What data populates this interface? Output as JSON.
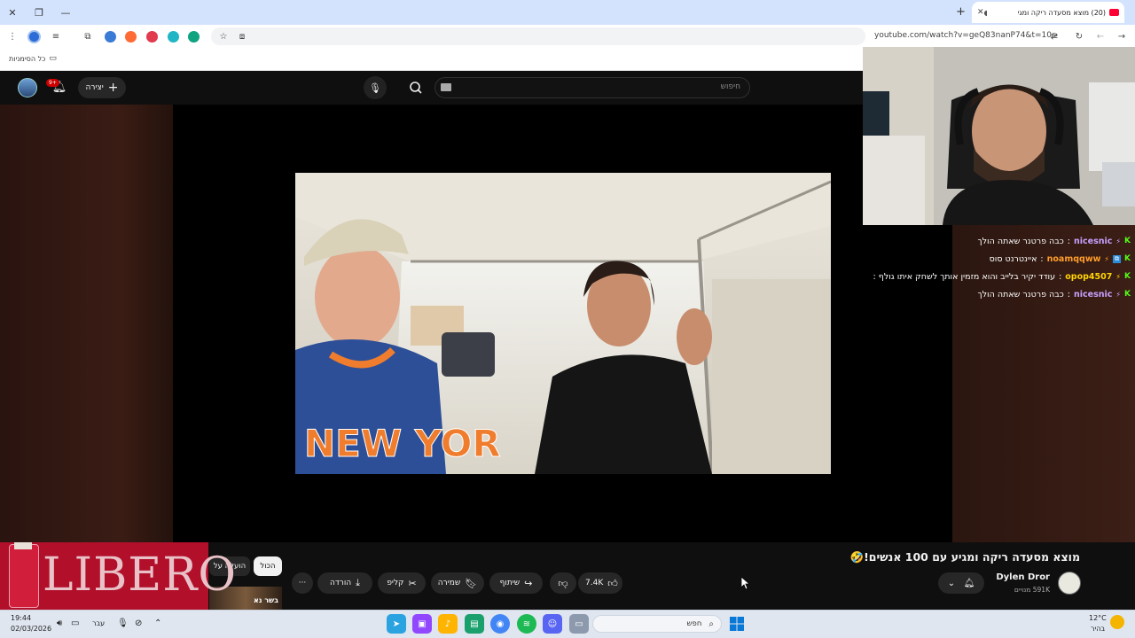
{
  "browser": {
    "tab_title": "(20) מוצא מסעדה ריקה ומגי",
    "url": "youtube.com/watch?v=geQ83nanP74&t=10s",
    "bookmarks_label": "כל הסימניות",
    "new_tab_label": "+"
  },
  "youtube": {
    "search_placeholder": "חיפוש",
    "create_label": "יצירה",
    "notification_badge": "9+",
    "video_title": "מוצא מסעדה ריקה ומגיע עם 100 אנשים!🤣",
    "channel_name": "Dylen Dror",
    "channel_subs": "591K מנויים",
    "likes": "7.4K",
    "share_label": "שיתוף",
    "save_label": "שמירה",
    "clip_label": "קליפ",
    "download_label": "הורדה",
    "more_label": "···",
    "chips": [
      "הכול",
      "הועלה על"
    ],
    "thumb_text": "בשר נא",
    "accent_color": "#ff0033"
  },
  "stream_chat": [
    {
      "user": "nicesnic",
      "message": "כבה פרטנר שאתה הולך",
      "user_color": "#c9a0ff"
    },
    {
      "user": "noamqqww",
      "message": "איינטרנט סוס",
      "user_color": "#ff9e2c"
    },
    {
      "user": "opop4507",
      "message": "עודד יקיר בלייב והוא מזמין אותך לשחק איתו גולף :",
      "user_color": "#ffd400"
    },
    {
      "user": "nicesnic",
      "message": "כבה פרטנר שאתה הולך",
      "user_color": "#c9a0ff"
    }
  ],
  "ad": {
    "brand": "LIBERO"
  },
  "taskbar": {
    "time": "19:44",
    "date": "02/03/2026",
    "weather_temp": "12°C",
    "weather_desc": "בהיר",
    "lang": "עבר",
    "search_label": "חפש"
  }
}
